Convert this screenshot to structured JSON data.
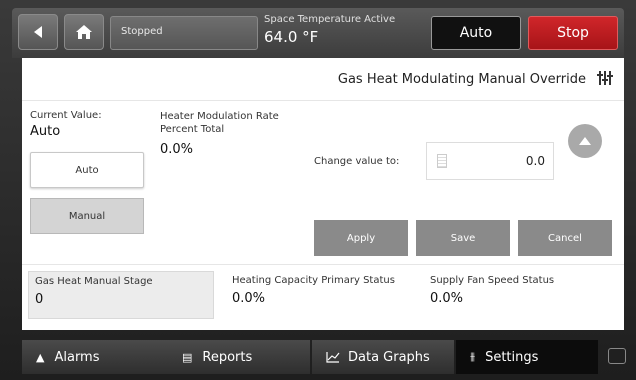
{
  "header": {
    "status": "Stopped",
    "space_temp_label": "Space Temperature Active",
    "space_temp_value": "64.0 °F",
    "mode_button": "Auto",
    "stop_button": "Stop"
  },
  "panel": {
    "title": "Gas Heat Modulating Manual Override",
    "current_value_label": "Current Value:",
    "current_value": "Auto",
    "rate_label": "Heater Modulation Rate Percent Total",
    "rate_value": "0.0%",
    "auto_button": "Auto",
    "manual_button": "Manual",
    "change_label": "Change value to:",
    "change_input_value": "0.0",
    "apply_button": "Apply",
    "save_button": "Save",
    "cancel_button": "Cancel"
  },
  "info": [
    {
      "label": "Gas Heat Manual Stage",
      "value": "0"
    },
    {
      "label": "Heating Capacity Primary Status",
      "value": "0.0%"
    },
    {
      "label": "Supply Fan Speed Status",
      "value": "0.0%"
    }
  ],
  "nav": [
    {
      "label": "Alarms",
      "icon": "alarm-icon"
    },
    {
      "label": "Reports",
      "icon": "report-icon"
    },
    {
      "label": "Data Graphs",
      "icon": "graph-icon"
    },
    {
      "label": "Settings",
      "icon": "settings-icon"
    }
  ],
  "colors": {
    "stop": "#c41e22",
    "active_nav": "#0c0c0c"
  }
}
